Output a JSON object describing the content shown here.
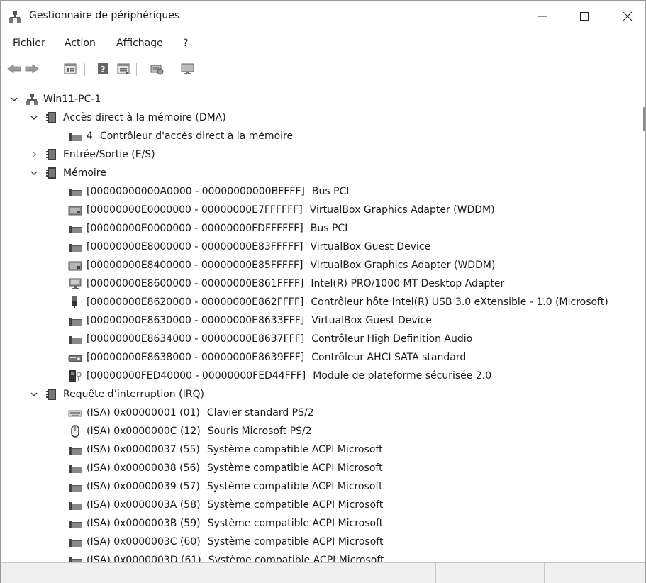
{
  "window": {
    "title": "Gestionnaire de périphériques",
    "controls": {
      "minimize": "—",
      "maximize": "☐",
      "close": "✕"
    }
  },
  "menu": [
    "Fichier",
    "Action",
    "Affichage",
    "?"
  ],
  "toolbar": [
    {
      "name": "back-icon"
    },
    {
      "name": "forward-icon"
    },
    {
      "name": "properties-icon"
    },
    {
      "name": "help-icon"
    },
    {
      "name": "show-hidden-icon"
    },
    {
      "name": "update-driver-icon"
    },
    {
      "name": "scan-hardware-icon"
    }
  ],
  "tree": {
    "root": "Win11-PC-1",
    "dma": {
      "label": "Accès direct à la mémoire (DMA)",
      "items": [
        {
          "res": "4",
          "device": "Contrôleur d'accès direct à la mémoire"
        }
      ]
    },
    "io": {
      "label": "Entrée/Sortie (E/S)"
    },
    "memory": {
      "label": "Mémoire",
      "items": [
        {
          "res": "[00000000000A0000 - 00000000000BFFFF]",
          "device": "Bus PCI",
          "icon": "chip"
        },
        {
          "res": "[00000000E0000000 - 00000000E7FFFFFF]",
          "device": "VirtualBox Graphics Adapter (WDDM)",
          "icon": "display"
        },
        {
          "res": "[00000000E0000000 - 00000000FDFFFFFF]",
          "device": "Bus PCI",
          "icon": "chip"
        },
        {
          "res": "[00000000E8000000 - 00000000E83FFFFF]",
          "device": "VirtualBox Guest Device",
          "icon": "chip"
        },
        {
          "res": "[00000000E8400000 - 00000000E85FFFFF]",
          "device": "VirtualBox Graphics Adapter (WDDM)",
          "icon": "display"
        },
        {
          "res": "[00000000E8600000 - 00000000E861FFFF]",
          "device": "Intel(R) PRO/1000 MT Desktop Adapter",
          "icon": "network"
        },
        {
          "res": "[00000000E8620000 - 00000000E862FFFF]",
          "device": "Contrôleur hôte Intel(R) USB 3.0 eXtensible - 1.0 (Microsoft)",
          "icon": "usb"
        },
        {
          "res": "[00000000E8630000 - 00000000E8633FFF]",
          "device": "VirtualBox Guest Device",
          "icon": "chip"
        },
        {
          "res": "[00000000E8634000 - 00000000E8637FFF]",
          "device": "Contrôleur High Definition Audio",
          "icon": "chip"
        },
        {
          "res": "[00000000E8638000 - 00000000E8639FFF]",
          "device": "Contrôleur AHCI SATA standard",
          "icon": "storage"
        },
        {
          "res": "[00000000FED40000 - 00000000FED44FFF]",
          "device": "Module de plateforme sécurisée 2.0",
          "icon": "tpm"
        }
      ]
    },
    "irq": {
      "label": "Requête d’interruption (IRQ)",
      "items": [
        {
          "res": "(ISA) 0x00000001 (01)",
          "device": "Clavier standard PS/2",
          "icon": "keyboard"
        },
        {
          "res": "(ISA) 0x0000000C (12)",
          "device": "Souris Microsoft PS/2",
          "icon": "mouse"
        },
        {
          "res": "(ISA) 0x00000037 (55)",
          "device": "Système compatible ACPI Microsoft",
          "icon": "chip"
        },
        {
          "res": "(ISA) 0x00000038 (56)",
          "device": "Système compatible ACPI Microsoft",
          "icon": "chip"
        },
        {
          "res": "(ISA) 0x00000039 (57)",
          "device": "Système compatible ACPI Microsoft",
          "icon": "chip"
        },
        {
          "res": "(ISA) 0x0000003A (58)",
          "device": "Système compatible ACPI Microsoft",
          "icon": "chip"
        },
        {
          "res": "(ISA) 0x0000003B (59)",
          "device": "Système compatible ACPI Microsoft",
          "icon": "chip"
        },
        {
          "res": "(ISA) 0x0000003C (60)",
          "device": "Système compatible ACPI Microsoft",
          "icon": "chip"
        },
        {
          "res": "(ISA) 0x0000003D (61)",
          "device": "Système compatible ACPI Microsoft",
          "icon": "chip"
        }
      ]
    }
  }
}
